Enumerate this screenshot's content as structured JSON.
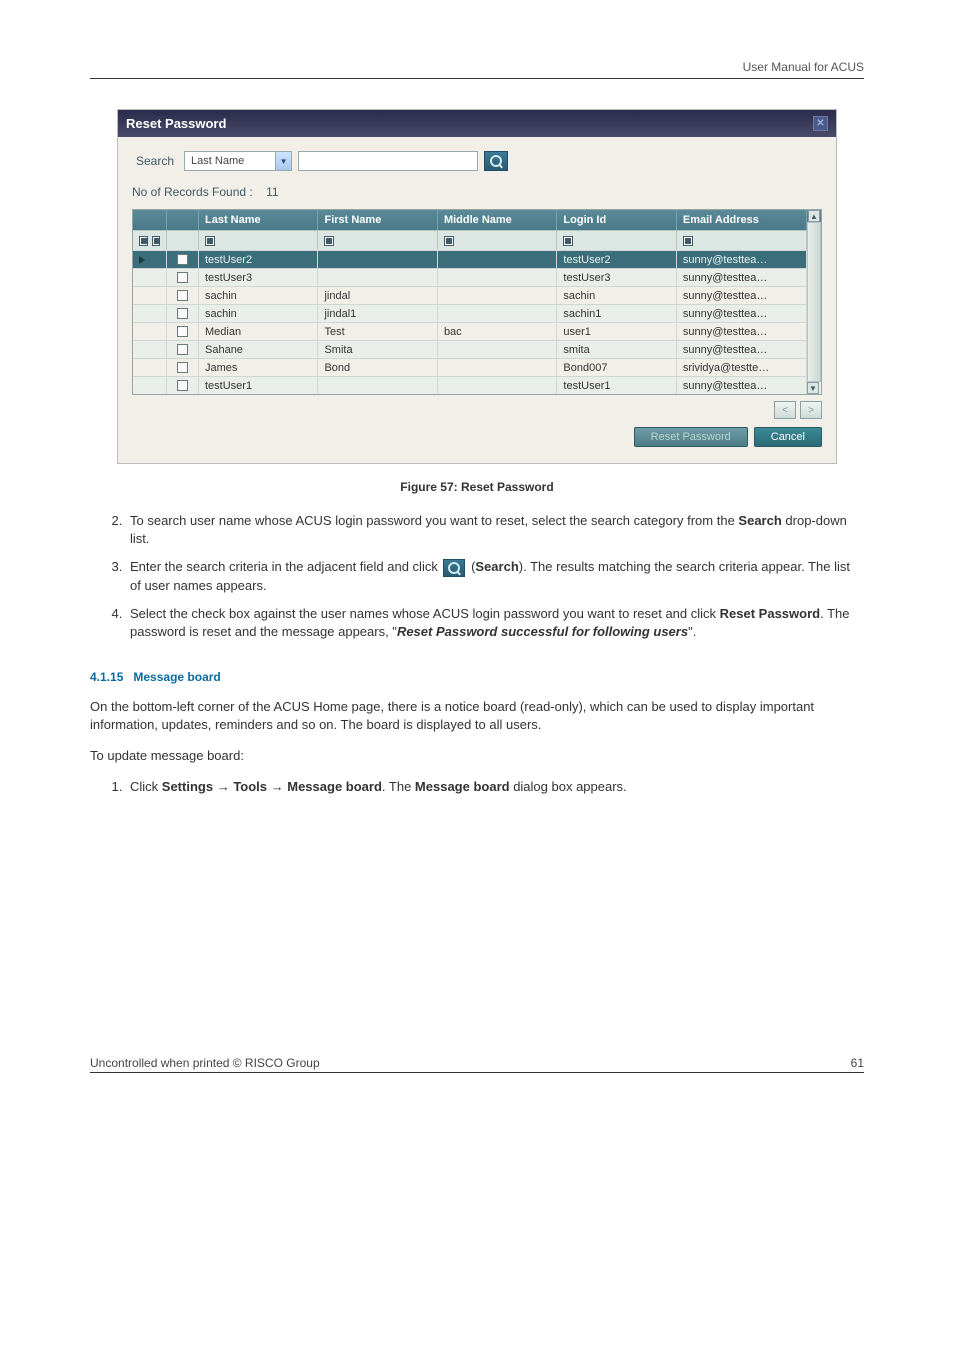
{
  "header": {
    "title": "User Manual for ACUS"
  },
  "dialog": {
    "title": "Reset Password",
    "search_label": "Search",
    "search_category": "Last Name",
    "search_value": "",
    "records_label": "No of Records Found :",
    "records_count": "11",
    "columns": {
      "last_name": "Last Name",
      "first_name": "First Name",
      "middle_name": "Middle Name",
      "login_id": "Login Id",
      "email": "Email Address"
    },
    "rows": [
      {
        "last": "testUser2",
        "first": "",
        "middle": "",
        "login": "testUser2",
        "email": "sunny@testtea…",
        "selected": true
      },
      {
        "last": "testUser3",
        "first": "",
        "middle": "",
        "login": "testUser3",
        "email": "sunny@testtea…"
      },
      {
        "last": "sachin",
        "first": "jindal",
        "middle": "",
        "login": "sachin",
        "email": "sunny@testtea…"
      },
      {
        "last": "sachin",
        "first": "jindal1",
        "middle": "",
        "login": "sachin1",
        "email": "sunny@testtea…"
      },
      {
        "last": "Median",
        "first": "Test",
        "middle": "bac",
        "login": "user1",
        "email": "sunny@testtea…"
      },
      {
        "last": "Sahane",
        "first": "Smita",
        "middle": "",
        "login": "smita",
        "email": "sunny@testtea…"
      },
      {
        "last": "James",
        "first": "Bond",
        "middle": "",
        "login": "Bond007",
        "email": "srividya@testte…"
      },
      {
        "last": "testUser1",
        "first": "",
        "middle": "",
        "login": "testUser1",
        "email": "sunny@testtea…"
      }
    ],
    "buttons": {
      "reset": "Reset Password",
      "cancel": "Cancel"
    }
  },
  "caption": "Figure 57: Reset Password",
  "instructions": {
    "i2a": "To search user name whose ACUS login password you want to reset, select the search category from the ",
    "i2b": "Search",
    "i2c": " drop-down list.",
    "i3a": "Enter the search criteria in the adjacent field and click ",
    "i3b": " (",
    "i3c": "Search",
    "i3d": "). The results matching the search criteria appear. The list of user names appears.",
    "i4a": "Select the check box against the user names whose ACUS login password you want to reset and click ",
    "i4b": "Reset Password",
    "i4c": ". The password is reset and the message appears, \"",
    "i4d": "Reset Password successful for following users",
    "i4e": "\"."
  },
  "section": {
    "num": "4.1.15",
    "title": "Message board",
    "p1": "On the bottom-left corner of the ACUS Home page, there is a notice board (read-only), which can be used to display important information, updates, reminders and so on. The board is displayed to all users.",
    "p2": "To update message board:",
    "step1a": "Click ",
    "step1b": "Settings",
    "arrow": " → ",
    "step1c": "Tools",
    "step1d": "Message board",
    "step1e": ". The ",
    "step1f": "Message board",
    "step1g": " dialog box appears."
  },
  "footer": {
    "left": "Uncontrolled when printed © RISCO Group",
    "page": "61"
  }
}
